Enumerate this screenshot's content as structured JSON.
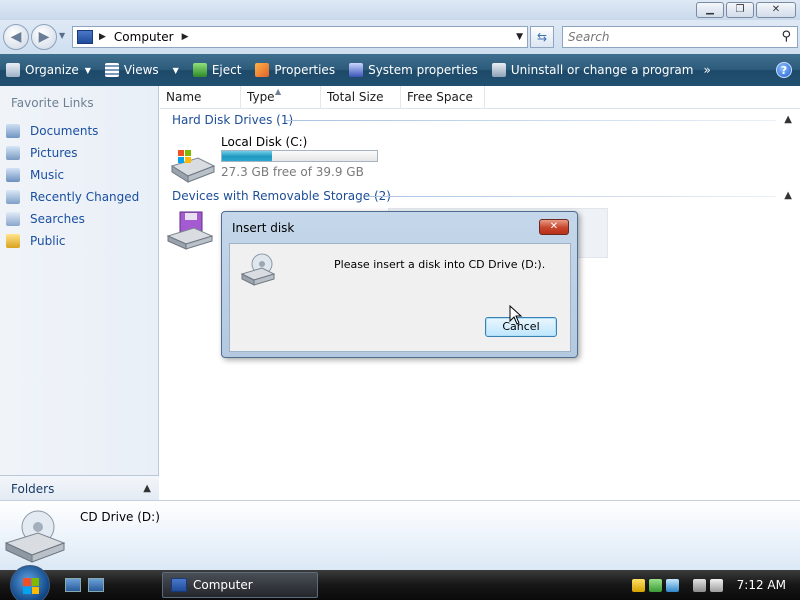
{
  "address": {
    "location": "Computer",
    "search_placeholder": "Search"
  },
  "toolbar": {
    "organize": "Organize",
    "views": "Views",
    "eject": "Eject",
    "properties": "Properties",
    "system_properties": "System properties",
    "uninstall": "Uninstall or change a program",
    "more": "»"
  },
  "sidebar": {
    "favorite_links_title": "Favorite Links",
    "items": [
      {
        "label": "Documents",
        "icon": "documents-icon"
      },
      {
        "label": "Pictures",
        "icon": "pictures-icon"
      },
      {
        "label": "Music",
        "icon": "music-icon"
      },
      {
        "label": "Recently Changed",
        "icon": "recently-changed-icon"
      },
      {
        "label": "Searches",
        "icon": "searches-icon"
      },
      {
        "label": "Public",
        "icon": "public-folder-icon"
      }
    ],
    "folders_label": "Folders"
  },
  "columns": [
    "Name",
    "Type",
    "Total Size",
    "Free Space"
  ],
  "groups": {
    "hard_disks": "Hard Disk Drives (1)",
    "removable": "Devices with Removable Storage (2)"
  },
  "drives": {
    "local_disk": {
      "name": "Local Disk (C:)",
      "free_text": "27.3 GB free of 39.9 GB",
      "used_fraction": 0.32
    }
  },
  "details_pane": {
    "name": "CD Drive (D:)"
  },
  "dialog": {
    "title": "Insert disk",
    "message": "Please insert a disk into CD Drive (D:).",
    "cancel": "Cancel"
  },
  "taskbar": {
    "task_label": "Computer",
    "clock": "7:12 AM"
  },
  "colors": {
    "command_bar": "#2d5b7c",
    "link_blue": "#1a4fa0",
    "group_blue": "#1c4e98"
  }
}
